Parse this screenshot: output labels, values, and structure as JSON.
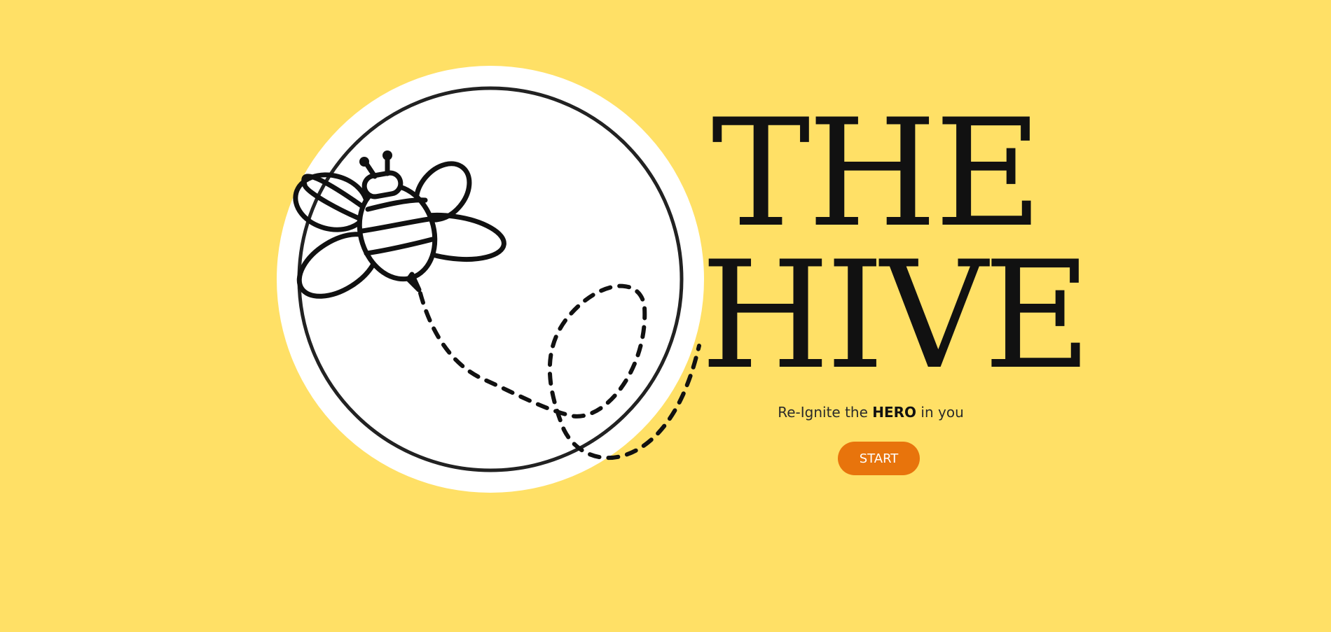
{
  "colors": {
    "background": "#FFE066",
    "accent": "#E8740C",
    "title_text": "#111111",
    "logo_circle": "#FFFFFF"
  },
  "logo": {
    "icon": "bee-icon",
    "trail": "dashed-flight-path"
  },
  "hero": {
    "title_line1": "THE",
    "title_line2": "HIVE",
    "tagline_prefix": "Re-Ignite the ",
    "tagline_emphasis": "HERO",
    "tagline_suffix": " in you",
    "start_label": "START"
  }
}
